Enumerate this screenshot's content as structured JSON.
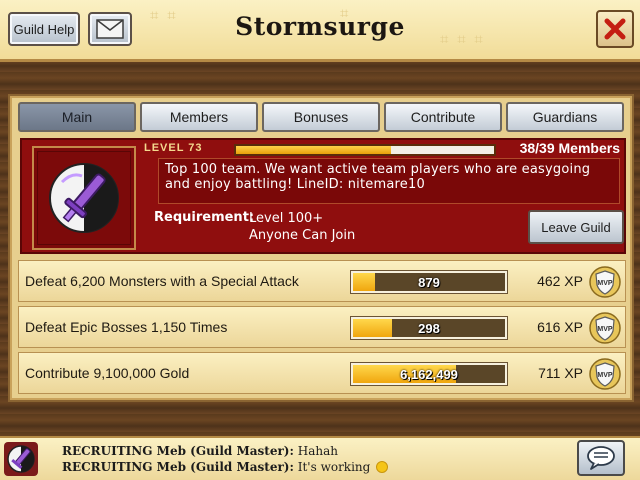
{
  "header": {
    "guild_help_label": "Guild Help",
    "title": "Stormsurge",
    "mail_icon": "envelope-icon",
    "close_icon": "close-x-icon"
  },
  "tabs": [
    {
      "label": "Main",
      "active": true
    },
    {
      "label": "Members",
      "active": false
    },
    {
      "label": "Bonuses",
      "active": false
    },
    {
      "label": "Contribute",
      "active": false
    },
    {
      "label": "Guardians",
      "active": false
    }
  ],
  "guild": {
    "level_label": "LEVEL 73",
    "level_progress": 0.6,
    "members": "38/39 Members",
    "description": "Top 100 team. We want active team players who are easygoing and enjoy battling! LineID: nitemare10",
    "requirement_label": "Requirement:",
    "requirement_level": "Level 100+",
    "requirement_join": "Anyone Can Join",
    "leave_label": "Leave Guild",
    "emblem_icon": "purple-sword-emblem-icon"
  },
  "quests": [
    {
      "text": "Defeat 6,200 Monsters with a Special Attack",
      "progress": 879,
      "progress_display": "879",
      "goal": 6200,
      "xp": "462 XP"
    },
    {
      "text": "Defeat Epic Bosses 1,150 Times",
      "progress": 298,
      "progress_display": "298",
      "goal": 1150,
      "xp": "616 XP"
    },
    {
      "text": "Contribute 9,100,000 Gold",
      "progress": 6162499,
      "progress_display": "6,162,499",
      "goal": 9100000,
      "xp": "711 XP"
    }
  ],
  "chat": {
    "lines": [
      {
        "prefix": "RECRUITING Meb (Guild Master):",
        "message": "Hahah"
      },
      {
        "prefix": "RECRUITING Meb (Guild Master):",
        "message": "It's working"
      }
    ],
    "chat_icon": "speech-bubble-icon"
  },
  "colors": {
    "info_panel": "#8f0e0e",
    "progress_fill": "#f0a60e",
    "accent_gold": "#f4d98e"
  }
}
